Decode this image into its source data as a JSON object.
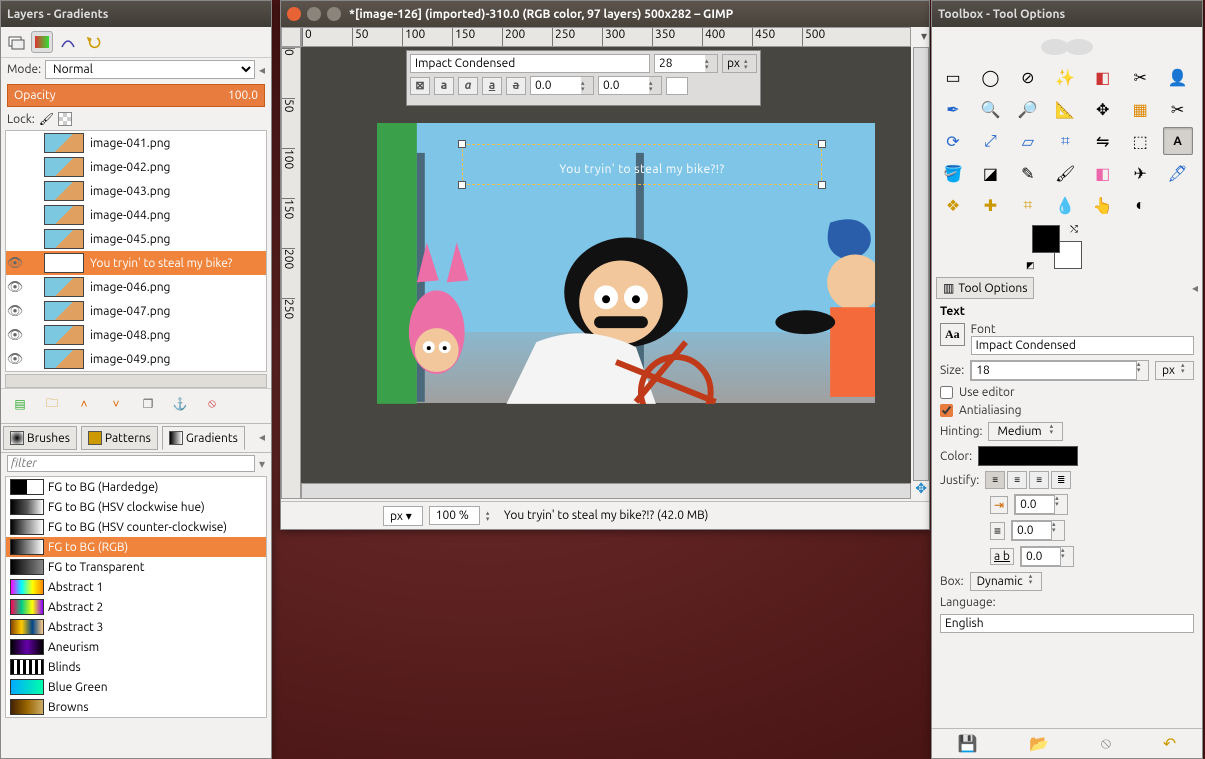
{
  "layers_panel": {
    "title": "Layers - Gradients",
    "mode_label": "Mode:",
    "mode_value": "Normal",
    "opacity_label": "Opacity",
    "opacity_value": "100.0",
    "lock_label": "Lock:",
    "layers": [
      {
        "eye": false,
        "name": "image-041.png",
        "text": false
      },
      {
        "eye": false,
        "name": "image-042.png",
        "text": false
      },
      {
        "eye": false,
        "name": "image-043.png",
        "text": false
      },
      {
        "eye": false,
        "name": "image-044.png",
        "text": false
      },
      {
        "eye": false,
        "name": "image-045.png",
        "text": false
      },
      {
        "eye": true,
        "name": "You tryin' to steal my bike?",
        "text": true,
        "selected": true
      },
      {
        "eye": true,
        "name": "image-046.png",
        "text": false
      },
      {
        "eye": true,
        "name": "image-047.png",
        "text": false
      },
      {
        "eye": true,
        "name": "image-048.png",
        "text": false
      },
      {
        "eye": true,
        "name": "image-049.png",
        "text": false
      }
    ],
    "sub_tabs": {
      "brushes": "Brushes",
      "patterns": "Patterns",
      "gradients": "Gradients"
    },
    "filter_placeholder": "filter",
    "gradients": [
      {
        "name": "FG to BG (Hardedge)",
        "css": "linear-gradient(90deg,#000 50%,#fff 50%)"
      },
      {
        "name": "FG to BG (HSV clockwise hue)",
        "css": "linear-gradient(90deg,#000,#555,#fff)"
      },
      {
        "name": "FG to BG (HSV counter-clockwise)",
        "css": "linear-gradient(90deg,#000,#888,#fff)"
      },
      {
        "name": "FG to BG (RGB)",
        "css": "linear-gradient(90deg,#000,#fff)",
        "selected": true
      },
      {
        "name": "FG to Transparent",
        "css": "linear-gradient(90deg,#000,#444,#888)"
      },
      {
        "name": "Abstract 1",
        "css": "linear-gradient(90deg,#f0f,#0ff,#ff0,#f80)"
      },
      {
        "name": "Abstract 2",
        "css": "linear-gradient(90deg,#f05,#0c8,#ff0,#80f)"
      },
      {
        "name": "Abstract 3",
        "css": "linear-gradient(90deg,#840,#fc0,#048,#fc8)"
      },
      {
        "name": "Aneurism",
        "css": "linear-gradient(90deg,#000,#60a,#000)"
      },
      {
        "name": "Blinds",
        "css": "repeating-linear-gradient(90deg,#000 0 3px,#fff 3px 6px)"
      },
      {
        "name": "Blue Green",
        "css": "linear-gradient(90deg,#0af,#0fa)"
      },
      {
        "name": "Browns",
        "css": "linear-gradient(90deg,#420,#960,#ca6)"
      }
    ]
  },
  "canvas_win": {
    "title": "*[image-126] (imported)-310.0 (RGB color, 97 layers) 500x282 – GIMP",
    "ruler_marks": [
      "0",
      "50",
      "100",
      "150",
      "200",
      "250",
      "300",
      "350",
      "400",
      "450",
      "500"
    ],
    "ruler_v": [
      "0",
      "50",
      "100",
      "150",
      "200",
      "250"
    ],
    "text_tool": {
      "font": "Impact Condensed",
      "size": "28",
      "unit": "px",
      "baseline": "0.0",
      "kerning": "0.0"
    },
    "text_content": "You tryin' to steal my bike?!?",
    "status": {
      "unit": "px",
      "zoom": "100 %",
      "msg": "You tryin' to steal my bike?!? (42.0 MB)"
    }
  },
  "toolbox": {
    "title": "Toolbox - Tool Options",
    "tab_label": "Tool Options",
    "text_header": "Text",
    "font_label": "Font",
    "font_value": "Impact Condensed",
    "size_label": "Size:",
    "size_value": "18",
    "size_unit": "px",
    "use_editor": "Use editor",
    "antialiasing": "Antialiasing",
    "hinting_label": "Hinting:",
    "hinting_value": "Medium",
    "color_label": "Color:",
    "justify_label": "Justify:",
    "indent_value": "0.0",
    "line_value": "0.0",
    "letter_value": "0.0",
    "box_label": "Box:",
    "box_value": "Dynamic",
    "lang_label": "Language:",
    "lang_value": "English"
  }
}
